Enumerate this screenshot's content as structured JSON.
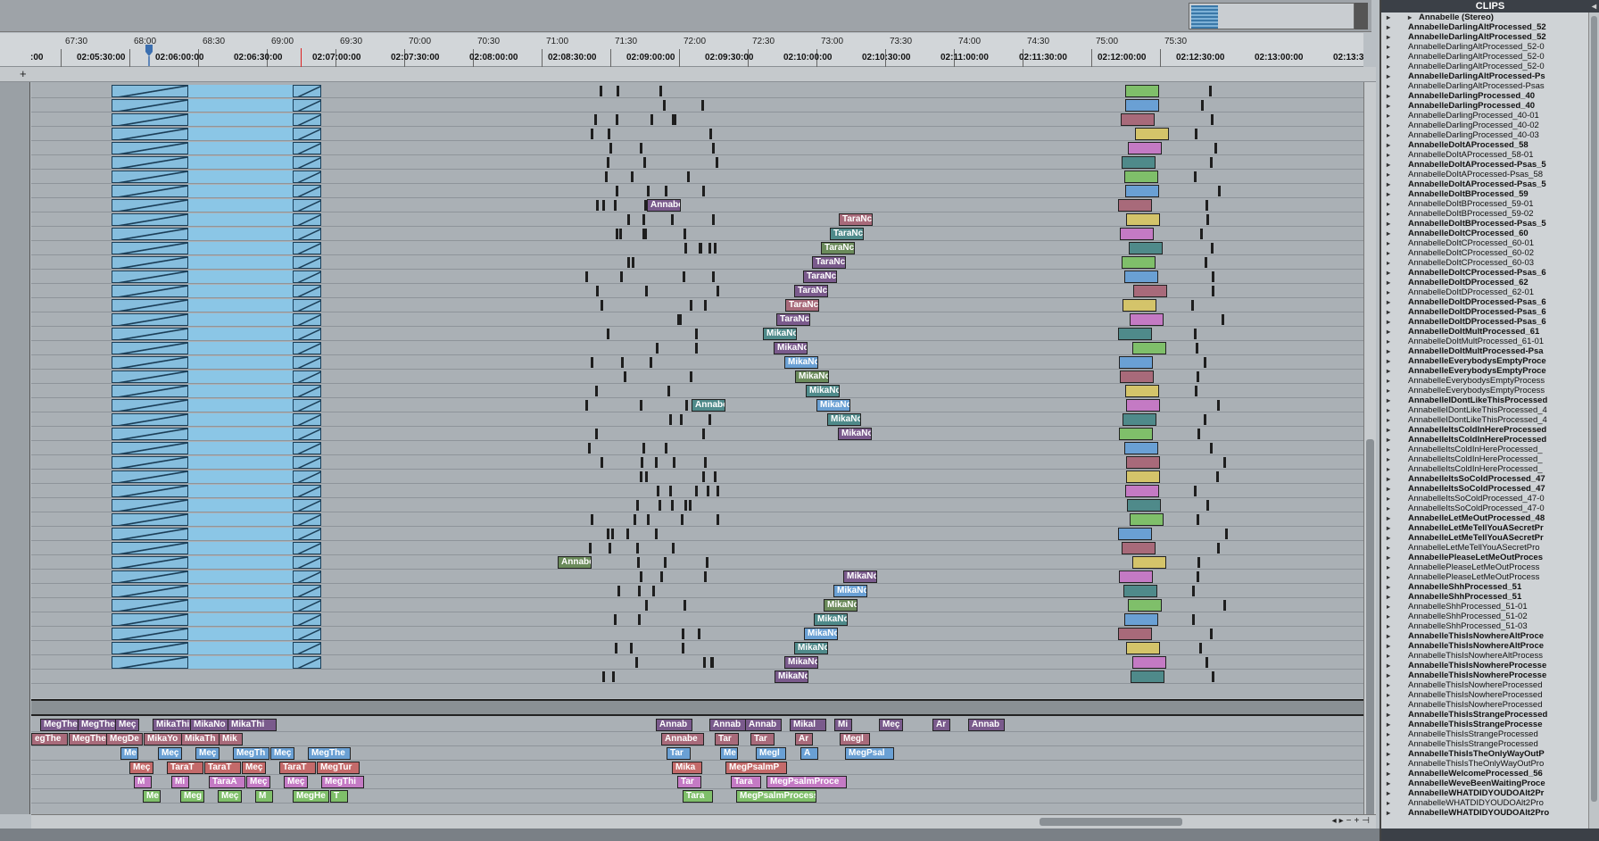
{
  "ruler": {
    "bars": [
      "67:30",
      "68:00",
      "68:30",
      "69:00",
      "69:30",
      "70:00",
      "70:30",
      "71:00",
      "71:30",
      "72:00",
      "72:30",
      "73:00",
      "73:30",
      "74:00",
      "74:30",
      "75:00",
      "75:30"
    ],
    "timecodes": [
      ":00",
      "02:05:30:00",
      "02:06:00:00",
      "02:06:30:00",
      "02:07:00:00",
      "02:07:30:00",
      "02:08:00:00",
      "02:08:30:00",
      "02:09:00:00",
      "02:09:30:00",
      "02:10:00:00",
      "02:10:30:00",
      "02:11:00:00",
      "02:11:30:00",
      "02:12:00:00",
      "02:12:30:00",
      "02:13:00:00",
      "02:13:3"
    ]
  },
  "toolbar": {
    "add_symbol": "+"
  },
  "track_clips": [
    {
      "row": 8,
      "label": "Annabe",
      "color": "purple"
    },
    {
      "row": 9,
      "label": "TaraNc",
      "color": "pink"
    },
    {
      "row": 10,
      "label": "TaraNc",
      "color": "teal"
    },
    {
      "row": 11,
      "label": "TaraNc",
      "color": "olive"
    },
    {
      "row": 12,
      "label": "TaraNc",
      "color": "purple"
    },
    {
      "row": 13,
      "label": "TaraNc",
      "color": "purple"
    },
    {
      "row": 14,
      "label": "TaraNc",
      "color": "purple"
    },
    {
      "row": 15,
      "label": "TaraNc",
      "color": "pink"
    },
    {
      "row": 16,
      "label": "TaraNc",
      "color": "purple"
    },
    {
      "row": 17,
      "label": "MikaNc",
      "color": "teal"
    },
    {
      "row": 18,
      "label": "MikaNc",
      "color": "purple"
    },
    {
      "row": 19,
      "label": "MikaNc",
      "color": "blue"
    },
    {
      "row": 20,
      "label": "MikaNc",
      "color": "olive"
    },
    {
      "row": 21,
      "label": "MikaNc",
      "color": "teal"
    },
    {
      "row": 22,
      "label": "Annabe",
      "color": "teal"
    },
    {
      "row": 22,
      "label": "MikaNc",
      "color": "blue"
    },
    {
      "row": 23,
      "label": "MikaNc",
      "color": "teal"
    },
    {
      "row": 24,
      "label": "MikaNc",
      "color": "purple"
    },
    {
      "row": 33,
      "label": "Annabe",
      "color": "olive"
    },
    {
      "row": 34,
      "label": "MikaNc",
      "color": "purple"
    },
    {
      "row": 35,
      "label": "MikaNc",
      "color": "blue"
    },
    {
      "row": 36,
      "label": "MikaNc",
      "color": "olive"
    },
    {
      "row": 37,
      "label": "MikaNc",
      "color": "teal"
    },
    {
      "row": 38,
      "label": "MikaNc",
      "color": "blue"
    },
    {
      "row": 39,
      "label": "MikaNc",
      "color": "teal"
    },
    {
      "row": 40,
      "label": "MikaNc",
      "color": "purple"
    },
    {
      "row": 41,
      "label": "MikaNc",
      "color": "purple"
    }
  ],
  "lower_clips": [
    {
      "row": 0,
      "label": "MegThe",
      "color": "purple"
    },
    {
      "row": 0,
      "label": "MegThe",
      "color": "purple"
    },
    {
      "row": 0,
      "label": "Meç",
      "color": "purple"
    },
    {
      "row": 0,
      "label": "MikaThi",
      "color": "purple"
    },
    {
      "row": 0,
      "label": "MikaNo",
      "color": "purple"
    },
    {
      "row": 0,
      "label": "MikaThi",
      "color": "purple"
    },
    {
      "row": 0,
      "label": "Annab",
      "color": "purple"
    },
    {
      "row": 0,
      "label": "Annab",
      "color": "purple"
    },
    {
      "row": 0,
      "label": "Annab",
      "color": "purple"
    },
    {
      "row": 0,
      "label": "Mikal",
      "color": "purple"
    },
    {
      "row": 0,
      "label": "Mi",
      "color": "purple"
    },
    {
      "row": 0,
      "label": "Meç",
      "color": "purple"
    },
    {
      "row": 0,
      "label": "Ar",
      "color": "purple"
    },
    {
      "row": 0,
      "label": "Annab",
      "color": "purple"
    },
    {
      "row": 1,
      "label": "egThe",
      "color": "pink"
    },
    {
      "row": 1,
      "label": "MegThe",
      "color": "pink"
    },
    {
      "row": 1,
      "label": "MegDe",
      "color": "pink"
    },
    {
      "row": 1,
      "label": "MikaYo",
      "color": "pink"
    },
    {
      "row": 1,
      "label": "MikaTh",
      "color": "pink"
    },
    {
      "row": 1,
      "label": "Mik",
      "color": "pink"
    },
    {
      "row": 1,
      "label": "Annabe",
      "color": "pink"
    },
    {
      "row": 1,
      "label": "Tar",
      "color": "pink"
    },
    {
      "row": 1,
      "label": "Tar",
      "color": "pink"
    },
    {
      "row": 1,
      "label": "Ar",
      "color": "pink"
    },
    {
      "row": 1,
      "label": "Megl",
      "color": "pink"
    },
    {
      "row": 2,
      "label": "Me",
      "color": "blue"
    },
    {
      "row": 2,
      "label": "Meç",
      "color": "blue"
    },
    {
      "row": 2,
      "label": "Meç",
      "color": "blue"
    },
    {
      "row": 2,
      "label": "MegTh",
      "color": "blue"
    },
    {
      "row": 2,
      "label": "Meç",
      "color": "blue"
    },
    {
      "row": 2,
      "label": "MegThe",
      "color": "blue"
    },
    {
      "row": 2,
      "label": "Tar",
      "color": "blue"
    },
    {
      "row": 2,
      "label": "Me",
      "color": "blue"
    },
    {
      "row": 2,
      "label": "Megl",
      "color": "blue"
    },
    {
      "row": 2,
      "label": "A",
      "color": "blue"
    },
    {
      "row": 2,
      "label": "MegPsal",
      "color": "blue"
    },
    {
      "row": 3,
      "label": "Meç",
      "color": "red"
    },
    {
      "row": 3,
      "label": "TaraT",
      "color": "red"
    },
    {
      "row": 3,
      "label": "TaraT",
      "color": "red"
    },
    {
      "row": 3,
      "label": "Meç",
      "color": "red"
    },
    {
      "row": 3,
      "label": "TaraT",
      "color": "red"
    },
    {
      "row": 3,
      "label": "MegTur",
      "color": "red"
    },
    {
      "row": 3,
      "label": "Mika",
      "color": "red"
    },
    {
      "row": 3,
      "label": "MegPsalmP",
      "color": "red"
    },
    {
      "row": 4,
      "label": "M",
      "color": "mag"
    },
    {
      "row": 4,
      "label": "Mi",
      "color": "mag"
    },
    {
      "row": 4,
      "label": "TaraA",
      "color": "mag"
    },
    {
      "row": 4,
      "label": "Meç",
      "color": "mag"
    },
    {
      "row": 4,
      "label": "Meç",
      "color": "mag"
    },
    {
      "row": 4,
      "label": "MegThi",
      "color": "mag"
    },
    {
      "row": 4,
      "label": "Tar",
      "color": "mag"
    },
    {
      "row": 4,
      "label": "Tara",
      "color": "mag"
    },
    {
      "row": 4,
      "label": "MegPsalmProce",
      "color": "mag"
    },
    {
      "row": 5,
      "label": "Me",
      "color": "green"
    },
    {
      "row": 5,
      "label": "Meg",
      "color": "green"
    },
    {
      "row": 5,
      "label": "Meç",
      "color": "green"
    },
    {
      "row": 5,
      "label": "M",
      "color": "green"
    },
    {
      "row": 5,
      "label": "MegHe",
      "color": "green"
    },
    {
      "row": 5,
      "label": "T",
      "color": "green"
    },
    {
      "row": 5,
      "label": "Tara",
      "color": "green"
    },
    {
      "row": 5,
      "label": "MegPsalmProcess",
      "color": "green"
    }
  ],
  "clips_panel": {
    "title": "CLIPS",
    "items": [
      {
        "name": "Annabelle (Stereo)",
        "bold": true,
        "stereo": true
      },
      {
        "name": "AnnabelleDarlingAltProcessed_52",
        "bold": true
      },
      {
        "name": "AnnabelleDarlingAltProcessed_52",
        "bold": true
      },
      {
        "name": "AnnabelleDarlingAltProcessed_52-0",
        "bold": false
      },
      {
        "name": "AnnabelleDarlingAltProcessed_52-0",
        "bold": false
      },
      {
        "name": "AnnabelleDarlingAltProcessed_52-0",
        "bold": false
      },
      {
        "name": "AnnabelleDarlingAltProcessed-Ps",
        "bold": true
      },
      {
        "name": "AnnabelleDarlingAltProcessed-Psas",
        "bold": false
      },
      {
        "name": "AnnabelleDarlingProcessed_40",
        "bold": true
      },
      {
        "name": "AnnabelleDarlingProcessed_40",
        "bold": true
      },
      {
        "name": "AnnabelleDarlingProcessed_40-01",
        "bold": false
      },
      {
        "name": "AnnabelleDarlingProcessed_40-02",
        "bold": false
      },
      {
        "name": "AnnabelleDarlingProcessed_40-03",
        "bold": false
      },
      {
        "name": "AnnabelleDoItAProcessed_58",
        "bold": true
      },
      {
        "name": "AnnabelleDoItAProcessed_58-01",
        "bold": false
      },
      {
        "name": "AnnabelleDoItAProcessed-Psas_5",
        "bold": true
      },
      {
        "name": "AnnabelleDoItAProcessed-Psas_58",
        "bold": false
      },
      {
        "name": "AnnabelleDoItAProcessed-Psas_5",
        "bold": true
      },
      {
        "name": "AnnabelleDoItBProcessed_59",
        "bold": true
      },
      {
        "name": "AnnabelleDoItBProcessed_59-01",
        "bold": false
      },
      {
        "name": "AnnabelleDoItBProcessed_59-02",
        "bold": false
      },
      {
        "name": "AnnabelleDoItBProcessed-Psas_5",
        "bold": true
      },
      {
        "name": "AnnabelleDoItCProcessed_60",
        "bold": true
      },
      {
        "name": "AnnabelleDoItCProcessed_60-01",
        "bold": false
      },
      {
        "name": "AnnabelleDoItCProcessed_60-02",
        "bold": false
      },
      {
        "name": "AnnabelleDoItCProcessed_60-03",
        "bold": false
      },
      {
        "name": "AnnabelleDoItCProcessed-Psas_6",
        "bold": true
      },
      {
        "name": "AnnabelleDoItDProcessed_62",
        "bold": true
      },
      {
        "name": "AnnabelleDoItDProcessed_62-01",
        "bold": false
      },
      {
        "name": "AnnabelleDoItDProcessed-Psas_6",
        "bold": true
      },
      {
        "name": "AnnabelleDoItDProcessed-Psas_6",
        "bold": true
      },
      {
        "name": "AnnabelleDoItDProcessed-Psas_6",
        "bold": true
      },
      {
        "name": "AnnabelleDoItMultProcessed_61",
        "bold": true
      },
      {
        "name": "AnnabelleDoItMultProcessed_61-01",
        "bold": false
      },
      {
        "name": "AnnabelleDoItMultProcessed-Psa",
        "bold": true
      },
      {
        "name": "AnnabelleEverybodysEmptyProce",
        "bold": true
      },
      {
        "name": "AnnabelleEverybodysEmptyProce",
        "bold": true
      },
      {
        "name": "AnnabelleEverybodysEmptyProcess",
        "bold": false
      },
      {
        "name": "AnnabelleEverybodysEmptyProcess",
        "bold": false
      },
      {
        "name": "AnnabelleIDontLikeThisProcessed",
        "bold": true
      },
      {
        "name": "AnnabelleIDontLikeThisProcessed_4",
        "bold": false
      },
      {
        "name": "AnnabelleIDontLikeThisProcessed_4",
        "bold": false
      },
      {
        "name": "AnnabelleItsColdInHereProcessed",
        "bold": true
      },
      {
        "name": "AnnabelleItsColdInHereProcessed",
        "bold": true
      },
      {
        "name": "AnnabelleItsColdInHereProcessed_",
        "bold": false
      },
      {
        "name": "AnnabelleItsColdInHereProcessed_",
        "bold": false
      },
      {
        "name": "AnnabelleItsColdInHereProcessed_",
        "bold": false
      },
      {
        "name": "AnnabelleItsSoColdProcessed_47",
        "bold": true
      },
      {
        "name": "AnnabelleItsSoColdProcessed_47",
        "bold": true
      },
      {
        "name": "AnnabelleItsSoColdProcessed_47-0",
        "bold": false
      },
      {
        "name": "AnnabelleItsSoColdProcessed_47-0",
        "bold": false
      },
      {
        "name": "AnnabelleLetMeOutProcessed_48",
        "bold": true
      },
      {
        "name": "AnnabelleLetMeTellYouASecretPr",
        "bold": true
      },
      {
        "name": "AnnabelleLetMeTellYouASecretPr",
        "bold": true
      },
      {
        "name": "AnnabelleLetMeTellYouASecretPro",
        "bold": false
      },
      {
        "name": "AnnabellePleaseLetMeOutProces",
        "bold": true
      },
      {
        "name": "AnnabellePleaseLetMeOutProcess",
        "bold": false
      },
      {
        "name": "AnnabellePleaseLetMeOutProcess",
        "bold": false
      },
      {
        "name": "AnnabelleShhProcessed_51",
        "bold": true
      },
      {
        "name": "AnnabelleShhProcessed_51",
        "bold": true
      },
      {
        "name": "AnnabelleShhProcessed_51-01",
        "bold": false
      },
      {
        "name": "AnnabelleShhProcessed_51-02",
        "bold": false
      },
      {
        "name": "AnnabelleShhProcessed_51-03",
        "bold": false
      },
      {
        "name": "AnnabelleThisIsNowhereAltProce",
        "bold": true
      },
      {
        "name": "AnnabelleThisIsNowhereAltProce",
        "bold": true
      },
      {
        "name": "AnnabelleThisIsNowhereAltProcess",
        "bold": false
      },
      {
        "name": "AnnabelleThisIsNowhereProcesse",
        "bold": true
      },
      {
        "name": "AnnabelleThisIsNowhereProcesse",
        "bold": true
      },
      {
        "name": "AnnabelleThisIsNowhereProcessed",
        "bold": false
      },
      {
        "name": "AnnabelleThisIsNowhereProcessed",
        "bold": false
      },
      {
        "name": "AnnabelleThisIsNowhereProcessed",
        "bold": false
      },
      {
        "name": "AnnabelleThisIsStrangeProcessed",
        "bold": true
      },
      {
        "name": "AnnabelleThisIsStrangeProcesse",
        "bold": true
      },
      {
        "name": "AnnabelleThisIsStrangeProcessed",
        "bold": false
      },
      {
        "name": "AnnabelleThisIsStrangeProcessed",
        "bold": false
      },
      {
        "name": "AnnabelleThisIsTheOnlyWayOutP",
        "bold": true
      },
      {
        "name": "AnnabelleThisIsTheOnlyWayOutPro",
        "bold": false
      },
      {
        "name": "AnnabelleWelcomeProcessed_56",
        "bold": true
      },
      {
        "name": "AnnabelleWeveBeenWaitingProce",
        "bold": true
      },
      {
        "name": "AnnabelleWHATDIDYOUDOAlt2Pr",
        "bold": true
      },
      {
        "name": "AnnabelleWHATDIDYOUDOAlt2Pro",
        "bold": false
      },
      {
        "name": "AnnabelleWHATDIDYOUDOAlt2Pro",
        "bold": true
      }
    ]
  }
}
